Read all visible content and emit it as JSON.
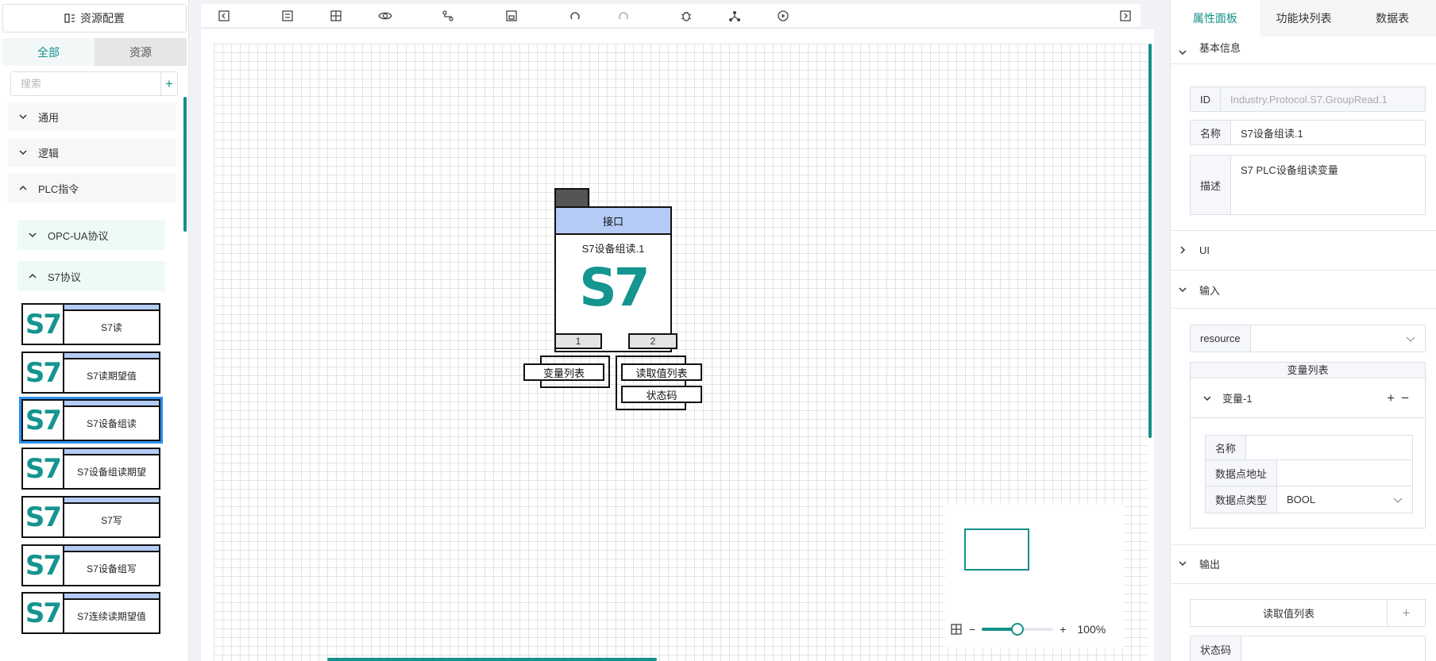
{
  "left": {
    "header_title": "资源配置",
    "tabs": [
      "全部",
      "资源"
    ],
    "search_placeholder": "搜索",
    "search_add": "+",
    "categories": [
      "通用",
      "逻辑",
      "PLC指令"
    ],
    "subcategories": [
      "OPC-UA协议",
      "S7协议"
    ],
    "blocks": [
      {
        "logo": "S7",
        "name": "S7读"
      },
      {
        "logo": "S7",
        "name": "S7读期望值"
      },
      {
        "logo": "S7",
        "name": "S7设备组读"
      },
      {
        "logo": "S7",
        "name": "S7设备组读期望"
      },
      {
        "logo": "S7",
        "name": "S7写"
      },
      {
        "logo": "S7",
        "name": "S7设备组写"
      },
      {
        "logo": "S7",
        "name": "S7连续读期望值"
      }
    ]
  },
  "node": {
    "header": "接口",
    "name": "S7设备组读.1",
    "logo": "S7",
    "port_1": "1",
    "port_2": "2",
    "input_pin": "变量列表",
    "output_pin_1": "读取值列表",
    "output_pin_2": "状态码"
  },
  "zoom": {
    "minus": "−",
    "plus": "+",
    "percent": "100%",
    "level_fraction": 0.5
  },
  "right": {
    "tabs": [
      "属性面板",
      "功能块列表",
      "数据表"
    ],
    "basic_section": "基本信息",
    "id_label": "ID",
    "id_value": "Industry.Protocol.S7.GroupRead.1",
    "name_label": "名称",
    "name_value": "S7设备组读.1",
    "desc_label": "描述",
    "desc_value": "S7 PLC设备组读变量",
    "ui_section": "UI",
    "input_section": "输入",
    "resource_label": "resource",
    "resource_value": "",
    "varlist_title": "变量列表",
    "var_item": "变量-1",
    "var_add": "+",
    "var_remove": "−",
    "var_name_label": "名称",
    "var_name_value": "",
    "var_addr_label": "数据点地址",
    "var_addr_value": "",
    "var_type_label": "数据点类型",
    "var_type_value": "BOOL",
    "output_section": "输出",
    "out_readlist": "读取值列表",
    "out_add": "+",
    "out_status_label": "状态码"
  },
  "colors": {
    "accent": "#15908a",
    "block_bar": "#b3cbf5",
    "selected_outline": "#2f8ff0"
  }
}
